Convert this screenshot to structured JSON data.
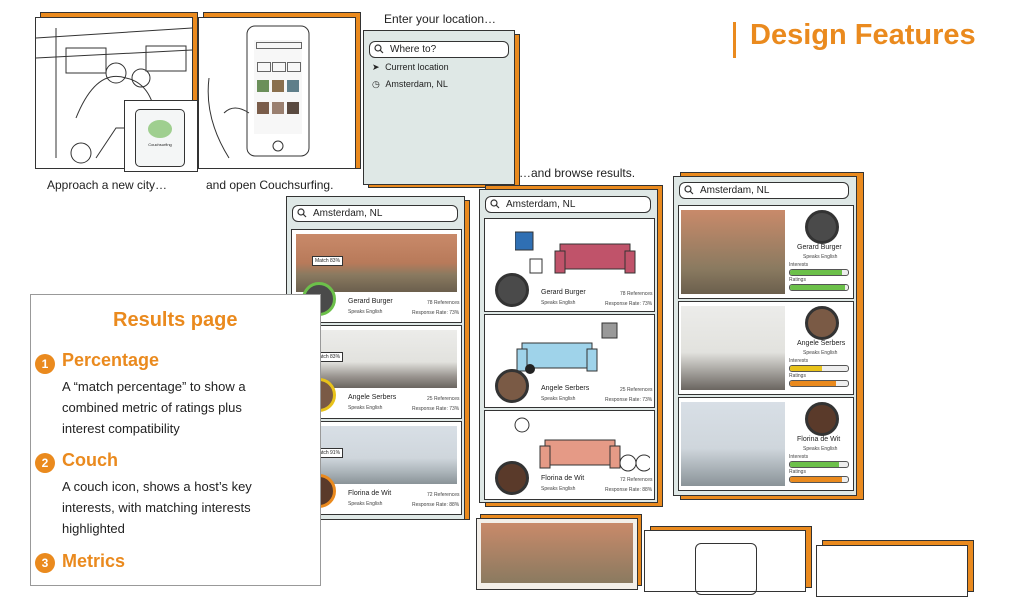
{
  "header": {
    "title": "Design Features",
    "accent": "#ea8a1e"
  },
  "storyboard": {
    "caption1": "Approach a new city…",
    "caption2": "and open Couchsurfing.",
    "caption3": "Enter your location…",
    "caption4": "…and browse results.",
    "search_placeholder": "Where to?",
    "current_location": "Current location",
    "recent_location": "Amsterdam, NL",
    "phone_app_name": "Couchsurfing"
  },
  "search_value": "Amsterdam, NL",
  "hosts": [
    {
      "name": "Gerard Burger",
      "language": "Speaks English",
      "references": "78 References",
      "response": "Response Rate: 73%",
      "match": "Match 83%"
    },
    {
      "name": "Angele Serbers",
      "language": "Speaks English",
      "references": "25 References",
      "response": "Response Rate: 73%",
      "match": "Match 83%"
    },
    {
      "name": "Florina de Wit",
      "language": "Speaks English",
      "references": "72 References",
      "response": "Response Rate: 88%",
      "match": "Match 91%"
    }
  ],
  "metrics": {
    "interests_label": "Interests",
    "ratings_label": "Ratings",
    "rows": [
      {
        "interests": 0.9,
        "ratings": 0.95
      },
      {
        "interests": 0.55,
        "ratings": 0.8
      },
      {
        "interests": 0.85,
        "ratings": 0.9
      }
    ]
  },
  "results_panel": {
    "heading": "Results page",
    "features": [
      {
        "number": "1",
        "title": "Percentage",
        "description": "A “match percentage” to show a combined metric of ratings plus interest compatibility"
      },
      {
        "number": "2",
        "title": "Couch",
        "description": "A couch icon, shows a host’s key interests, with matching interests highlighted"
      },
      {
        "number": "3",
        "title": "Metrics",
        "description": ""
      }
    ]
  }
}
